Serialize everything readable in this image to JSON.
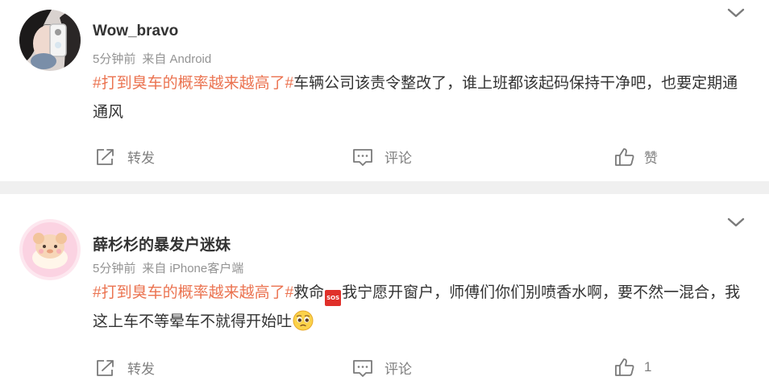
{
  "posts": [
    {
      "username": "Wow_bravo",
      "time": "5分钟前",
      "source": "来自 Android",
      "topic": "#打到臭车的概率越来越高了#",
      "text": "车辆公司该责令整改了，谁上班都该起码保持干净吧，也要定期通通风",
      "actions": {
        "forward": "转发",
        "comment": "评论",
        "like": "赞"
      }
    },
    {
      "username": "薛杉杉的暴发户迷妹",
      "time": "5分钟前",
      "source": "来自 iPhone客户端",
      "topic": "#打到臭车的概率越来越高了#",
      "text_before_icon": "救命",
      "sos_icon_text": "SOS",
      "text_after_icon": "我宁愿开窗户，师傅们你们别喷香水啊，要不然一混合，我这上车不等晕车不就得开始吐",
      "actions": {
        "forward": "转发",
        "comment": "评论",
        "like": "1"
      }
    }
  ],
  "icons": {
    "menu": "chevron-down-icon",
    "forward": "forward-icon",
    "comment": "comment-icon",
    "like": "thumbs-up-icon",
    "sos": "sos-icon",
    "emoji": "pleading-face-icon"
  },
  "colors": {
    "topic": "#eb7350",
    "username": "#333333",
    "meta": "#939393",
    "action": "#808080",
    "separator": "#f0f0f0"
  }
}
